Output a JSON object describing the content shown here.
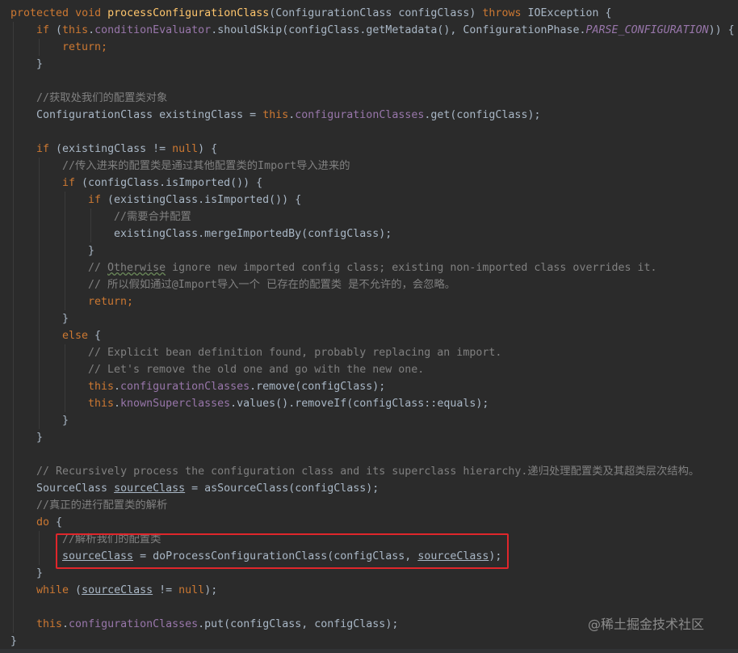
{
  "colors": {
    "background": "#2b2b2b",
    "default": "#a9b7c6",
    "keyword": "#cc7832",
    "method_decl": "#ffc66d",
    "field": "#9876aa",
    "comment": "#808080",
    "highlight_box": "#e0262b"
  },
  "code": {
    "lines": [
      {
        "indent": 0,
        "tokens": [
          {
            "t": "protected ",
            "c": "keyword"
          },
          {
            "t": "void ",
            "c": "keyword"
          },
          {
            "t": "processConfigurationClass",
            "c": "method_decl"
          },
          {
            "t": "(ConfigurationClass configClass) ",
            "c": "default"
          },
          {
            "t": "throws ",
            "c": "keyword"
          },
          {
            "t": "IOException {",
            "c": "default"
          }
        ]
      },
      {
        "indent": 1,
        "tokens": [
          {
            "t": "if ",
            "c": "keyword"
          },
          {
            "t": "(",
            "c": "default"
          },
          {
            "t": "this",
            "c": "keyword"
          },
          {
            "t": ".",
            "c": "default"
          },
          {
            "t": "conditionEvaluator",
            "c": "field"
          },
          {
            "t": ".shouldSkip(configClass.getMetadata(), ConfigurationPhase.",
            "c": "default"
          },
          {
            "t": "PARSE_CONFIGURATION",
            "c": "field",
            "i": true
          },
          {
            "t": ")) {",
            "c": "default"
          }
        ]
      },
      {
        "indent": 2,
        "tokens": [
          {
            "t": "return;",
            "c": "keyword"
          }
        ]
      },
      {
        "indent": 1,
        "tokens": [
          {
            "t": "}",
            "c": "default"
          }
        ]
      },
      {
        "indent": 0,
        "tokens": []
      },
      {
        "indent": 1,
        "tokens": [
          {
            "t": "//获取处我们的配置类对象",
            "c": "comment"
          }
        ]
      },
      {
        "indent": 1,
        "tokens": [
          {
            "t": "ConfigurationClass existingClass = ",
            "c": "default"
          },
          {
            "t": "this",
            "c": "keyword"
          },
          {
            "t": ".",
            "c": "default"
          },
          {
            "t": "configurationClasses",
            "c": "field"
          },
          {
            "t": ".get(configClass);",
            "c": "default"
          }
        ]
      },
      {
        "indent": 0,
        "tokens": []
      },
      {
        "indent": 1,
        "tokens": [
          {
            "t": "if ",
            "c": "keyword"
          },
          {
            "t": "(existingClass != ",
            "c": "default"
          },
          {
            "t": "null",
            "c": "keyword"
          },
          {
            "t": ") {",
            "c": "default"
          }
        ]
      },
      {
        "indent": 2,
        "tokens": [
          {
            "t": "//传入进来的配置类是通过其他配置类的Import导入进来的",
            "c": "comment"
          }
        ]
      },
      {
        "indent": 2,
        "tokens": [
          {
            "t": "if ",
            "c": "keyword"
          },
          {
            "t": "(configClass.isImported()) {",
            "c": "default"
          }
        ]
      },
      {
        "indent": 3,
        "tokens": [
          {
            "t": "if ",
            "c": "keyword"
          },
          {
            "t": "(existingClass.isImported()) {",
            "c": "default"
          }
        ]
      },
      {
        "indent": 4,
        "tokens": [
          {
            "t": "//需要合并配置",
            "c": "comment"
          }
        ]
      },
      {
        "indent": 4,
        "tokens": [
          {
            "t": "existingClass.mergeImportedBy(configClass);",
            "c": "default"
          }
        ]
      },
      {
        "indent": 3,
        "tokens": [
          {
            "t": "}",
            "c": "default"
          }
        ]
      },
      {
        "indent": 3,
        "tokens": [
          {
            "t": "// ",
            "c": "comment"
          },
          {
            "t": "Otherwise",
            "c": "comment",
            "s": true
          },
          {
            "t": " ignore new imported config class; existing non-imported class overrides it.",
            "c": "comment"
          }
        ]
      },
      {
        "indent": 3,
        "tokens": [
          {
            "t": "// 所以假如通过@Import导入一个 已存在的配置类 是不允许的，会忽略。",
            "c": "comment"
          }
        ]
      },
      {
        "indent": 3,
        "tokens": [
          {
            "t": "return;",
            "c": "keyword"
          }
        ]
      },
      {
        "indent": 2,
        "tokens": [
          {
            "t": "}",
            "c": "default"
          }
        ]
      },
      {
        "indent": 2,
        "tokens": [
          {
            "t": "else ",
            "c": "keyword"
          },
          {
            "t": "{",
            "c": "default"
          }
        ]
      },
      {
        "indent": 3,
        "tokens": [
          {
            "t": "// Explicit bean definition found, probably replacing an import.",
            "c": "comment"
          }
        ]
      },
      {
        "indent": 3,
        "tokens": [
          {
            "t": "// Let's remove the old one and go with the new one.",
            "c": "comment"
          }
        ]
      },
      {
        "indent": 3,
        "tokens": [
          {
            "t": "this",
            "c": "keyword"
          },
          {
            "t": ".",
            "c": "default"
          },
          {
            "t": "configurationClasses",
            "c": "field"
          },
          {
            "t": ".remove(configClass);",
            "c": "default"
          }
        ]
      },
      {
        "indent": 3,
        "tokens": [
          {
            "t": "this",
            "c": "keyword"
          },
          {
            "t": ".",
            "c": "default"
          },
          {
            "t": "knownSuperclasses",
            "c": "field"
          },
          {
            "t": ".values().removeIf(configClass::equals);",
            "c": "default"
          }
        ]
      },
      {
        "indent": 2,
        "tokens": [
          {
            "t": "}",
            "c": "default"
          }
        ]
      },
      {
        "indent": 1,
        "tokens": [
          {
            "t": "}",
            "c": "default"
          }
        ]
      },
      {
        "indent": 0,
        "tokens": []
      },
      {
        "indent": 1,
        "tokens": [
          {
            "t": "// Recursively process the configuration class and its superclass hierarchy.递归处理配置类及其超类层次结构。",
            "c": "comment"
          }
        ]
      },
      {
        "indent": 1,
        "tokens": [
          {
            "t": "SourceClass ",
            "c": "default"
          },
          {
            "t": "sourceClass",
            "c": "default",
            "u": true
          },
          {
            "t": " = asSourceClass(configClass);",
            "c": "default"
          }
        ]
      },
      {
        "indent": 1,
        "tokens": [
          {
            "t": "//真正的进行配置类的解析",
            "c": "comment"
          }
        ]
      },
      {
        "indent": 1,
        "tokens": [
          {
            "t": "do ",
            "c": "keyword"
          },
          {
            "t": "{",
            "c": "default"
          }
        ]
      },
      {
        "indent": 2,
        "tokens": [
          {
            "t": "//解析我们的配置类",
            "c": "comment"
          }
        ]
      },
      {
        "indent": 2,
        "tokens": [
          {
            "t": "sourceClass",
            "c": "default",
            "u": true
          },
          {
            "t": " = doProcessConfigurationClass(configClass, ",
            "c": "default"
          },
          {
            "t": "sourceClass",
            "c": "default",
            "u": true
          },
          {
            "t": ");",
            "c": "default"
          }
        ]
      },
      {
        "indent": 1,
        "tokens": [
          {
            "t": "}",
            "c": "default"
          }
        ]
      },
      {
        "indent": 1,
        "tokens": [
          {
            "t": "while ",
            "c": "keyword"
          },
          {
            "t": "(",
            "c": "default"
          },
          {
            "t": "sourceClass",
            "c": "default",
            "u": true
          },
          {
            "t": " != ",
            "c": "default"
          },
          {
            "t": "null",
            "c": "keyword"
          },
          {
            "t": ");",
            "c": "default"
          }
        ]
      },
      {
        "indent": 0,
        "tokens": []
      },
      {
        "indent": 1,
        "tokens": [
          {
            "t": "this",
            "c": "keyword"
          },
          {
            "t": ".",
            "c": "default"
          },
          {
            "t": "configurationClasses",
            "c": "field"
          },
          {
            "t": ".put(configClass, configClass);",
            "c": "default"
          }
        ]
      },
      {
        "indent": 0,
        "tokens": [
          {
            "t": "}",
            "c": "default"
          }
        ]
      }
    ]
  },
  "watermark": "@稀土掘金技术社区"
}
